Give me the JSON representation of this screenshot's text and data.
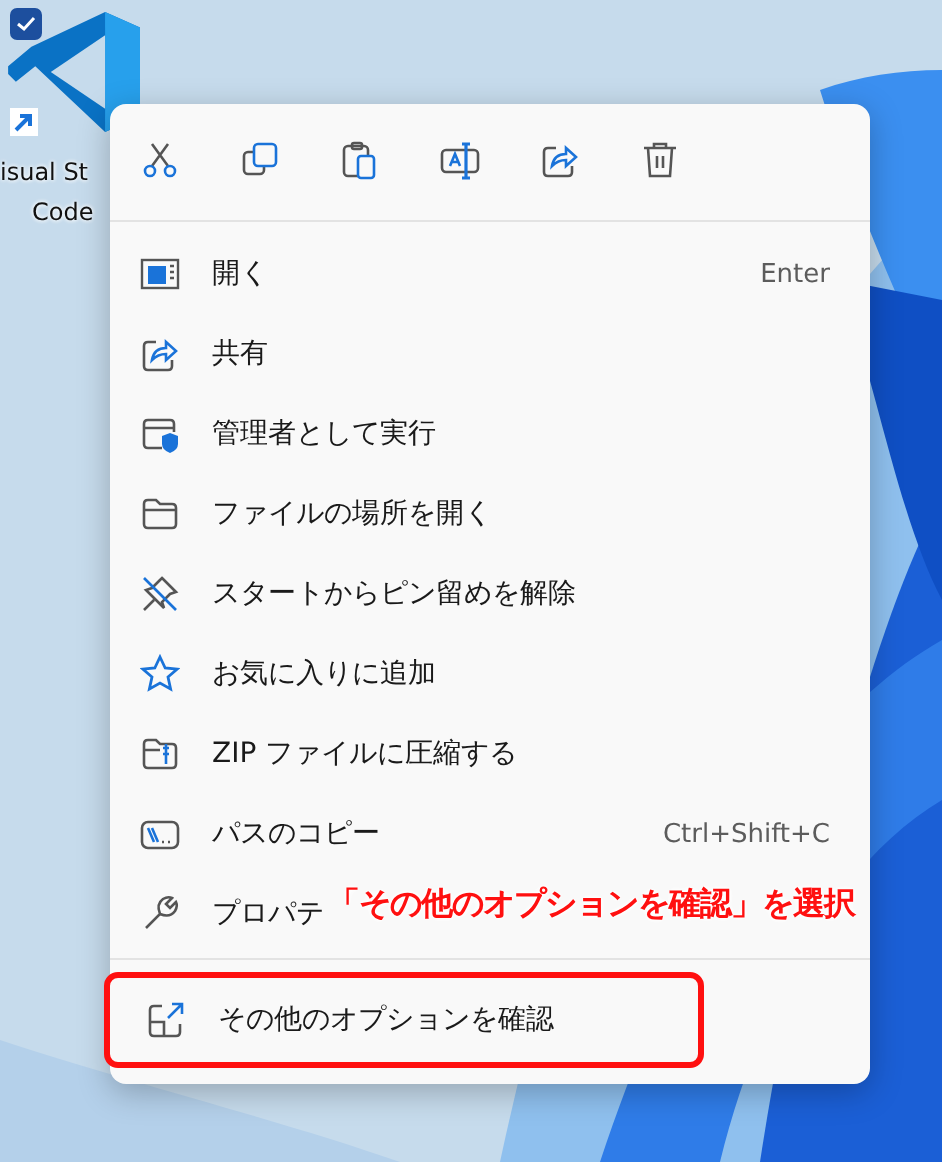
{
  "desktop_icon": {
    "checked": true,
    "label_lines": [
      "isual St",
      "Code"
    ]
  },
  "context_menu": {
    "items": [
      {
        "label": "開く",
        "shortcut": "Enter"
      },
      {
        "label": "共有"
      },
      {
        "label": "管理者として実行"
      },
      {
        "label": "ファイルの場所を開く"
      },
      {
        "label": "スタートからピン留めを解除"
      },
      {
        "label": "お気に入りに追加"
      },
      {
        "label": "ZIP ファイルに圧縮する"
      },
      {
        "label": "パスのコピー",
        "shortcut": "Ctrl+Shift+C"
      },
      {
        "label": "プロパテ"
      }
    ],
    "more_options": {
      "label": "その他のオプションを確認",
      "highlighted": true
    }
  },
  "annotation": {
    "text": "「その他のオプションを確認」を選択"
  }
}
